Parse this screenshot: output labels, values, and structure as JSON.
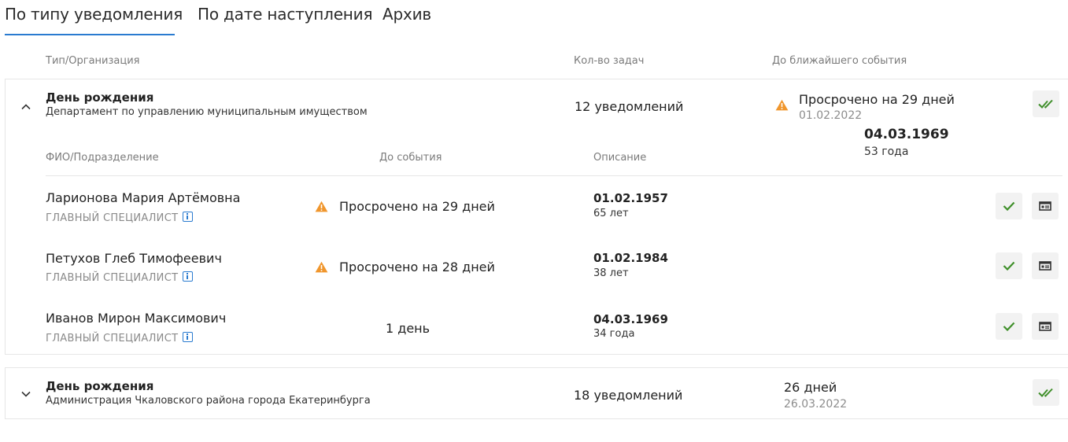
{
  "tabs": [
    {
      "label": "По типу уведомления",
      "active": true
    },
    {
      "label": "По дате наступления",
      "active": false
    },
    {
      "label": "Архив",
      "active": false
    }
  ],
  "columns": {
    "type_org": "Тип/Организация",
    "task_count": "Кол-во задач",
    "nearest_event": "До ближайшего события"
  },
  "groups": [
    {
      "title": "День рождения",
      "organization": "Департамент по управлению муниципальным имуществом",
      "count": "12 уведомлений",
      "status": "Просрочено на 29 дней",
      "date": "01.02.2022",
      "expanded": true,
      "tooltip": {
        "date": "04.03.1969",
        "age": "53 года"
      },
      "sub_columns": {
        "person": "ФИО/Подразделение",
        "until_event": "До события",
        "description": "Описание"
      },
      "rows": [
        {
          "name": "Ларионова Мария Артёмовна",
          "role": "ГЛАВНЫЙ СПЕЦИАЛИСТ",
          "status": "Просрочено на 29 дней",
          "overdue": true,
          "date": "01.02.1957",
          "age": "65 лет"
        },
        {
          "name": "Петухов Глеб Тимофеевич",
          "role": "ГЛАВНЫЙ СПЕЦИАЛИСТ",
          "status": "Просрочено на 28 дней",
          "overdue": true,
          "date": "01.02.1984",
          "age": "38 лет"
        },
        {
          "name": "Иванов Мирон Максимович",
          "role": "ГЛАВНЫЙ СПЕЦИАЛИСТ",
          "status": "1 день",
          "overdue": false,
          "date": "04.03.1969",
          "age": "34 года"
        }
      ]
    },
    {
      "title": "День рождения",
      "organization": "Администрация Чкаловского района города Екатеринбурга",
      "count": "18 уведомлений",
      "status": "26 дней",
      "date": "26.03.2022",
      "expanded": false
    }
  ],
  "colors": {
    "accent": "#2a7bd0",
    "warning": "#f0962d",
    "check": "#3f8f2a",
    "button_bg": "#f2f2f2"
  },
  "icons": {
    "expanded": "chevron-up-icon",
    "collapsed": "chevron-down-icon",
    "warning": "warning-icon",
    "check": "check-icon",
    "double_check": "double-check-icon",
    "card": "card-icon",
    "info": "info-icon"
  }
}
